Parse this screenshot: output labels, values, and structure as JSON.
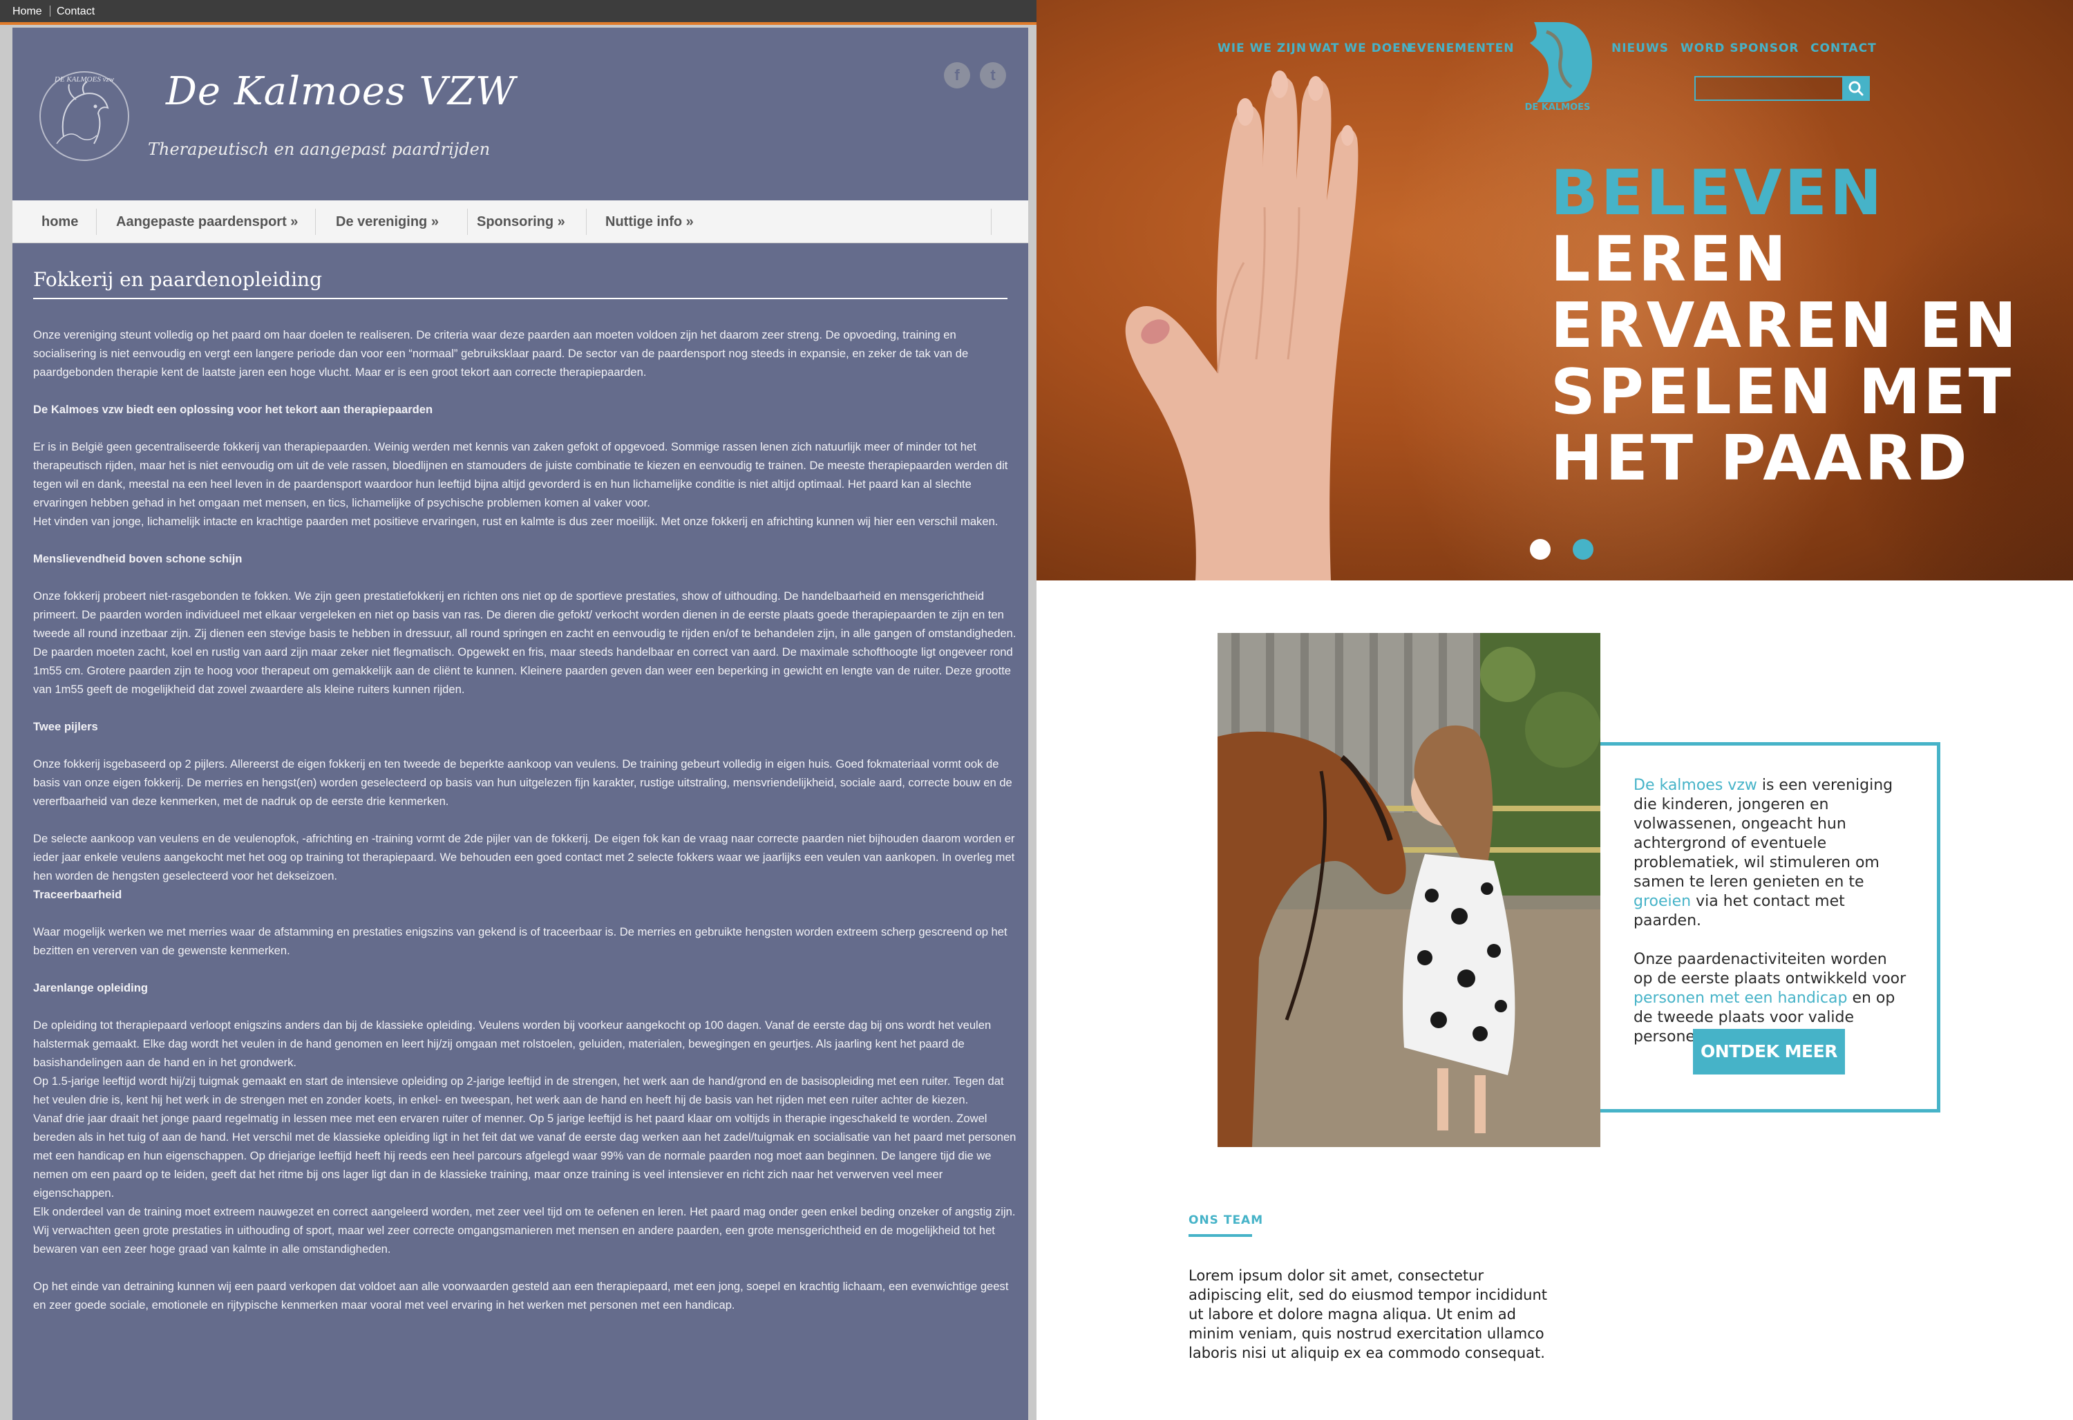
{
  "left": {
    "topbar": {
      "links": [
        "Home",
        "Contact"
      ]
    },
    "header": {
      "title": "De Kalmoes VZW",
      "subtitle": "Therapeutisch en aangepast paardrijden",
      "logo_text": "DE KALMOES vzw",
      "social": {
        "facebook": "f",
        "twitter": "t"
      }
    },
    "nav": [
      "home",
      "Aangepaste paardensport »",
      "De vereniging »",
      "Sponsoring »",
      "Nuttige info »"
    ],
    "article": {
      "title": "Fokkerij en paardenopleiding",
      "paragraphs": [
        "Onze vereniging steunt volledig op het paard om haar doelen te realiseren. De criteria waar deze paarden aan moeten voldoen zijn het daarom zeer streng. De opvoeding, training en socialisering is niet eenvoudig en vergt een langere periode dan voor een “normaal” gebruiksklaar paard. De sector van de paardensport nog steeds in expansie, en zeker de tak van de paardgebonden therapie kent de laatste jaren een hoge vlucht. Maar er is een groot tekort aan correcte therapiepaarden.",
        "De Kalmoes vzw biedt een oplossing voor het tekort aan therapiepaarden",
        "Er is in België geen gecentraliseerde fokkerij van therapiepaarden. Weinig werden met kennis van zaken gefokt of opgevoed. Sommige rassen lenen zich natuurlijk meer of minder tot het therapeutisch rijden, maar het is niet eenvoudig om uit de vele rassen, bloedlijnen en stamouders de juiste combinatie te kiezen en eenvoudig te trainen. De meeste therapiepaarden werden dit tegen wil en dank, meestal na een heel leven in de paardensport waardoor hun leeftijd bijna altijd gevorderd is en hun lichamelijke conditie is niet altijd optimaal. Het paard kan al slechte ervaringen hebben gehad in het omgaan met mensen, en tics, lichamelijke of psychische problemen komen al vaker voor.",
        "Het vinden van jonge, lichamelijk intacte en krachtige paarden met positieve ervaringen, rust en kalmte is dus zeer moeilijk. Met onze fokkerij en africhting kunnen wij hier een verschil maken.",
        "Menslievendheid boven schone schijn",
        "Onze fokkerij probeert niet-rasgebonden te fokken. We zijn geen prestatiefokkerij en richten ons niet op de sportieve prestaties, show of uithouding. De handelbaarheid en mensgerichtheid primeert. De paarden worden individueel met elkaar vergeleken en niet op basis van ras. De dieren die gefokt/ verkocht worden dienen in de eerste plaats goede therapiepaarden te zijn en ten tweede all round inzetbaar zijn. Zij dienen een stevige basis te hebben in dressuur, all round springen en zacht en eenvoudig te rijden en/of te behandelen zijn, in alle gangen of omstandigheden. De paarden moeten zacht, koel en rustig van aard zijn maar zeker niet flegmatisch. Opgewekt en fris, maar steeds handelbaar en correct van aard. De maximale schofthoogte ligt ongeveer rond 1m55 cm. Grotere paarden zijn te hoog voor therapeut om gemakkelijk aan de cliënt te kunnen. Kleinere paarden geven dan weer een beperking in gewicht en lengte van de ruiter. Deze grootte van 1m55 geeft de mogelijkheid dat zowel zwaardere als kleine ruiters kunnen rijden.",
        "Twee pijlers",
        "Onze fokkerij isgebaseerd op 2 pijlers. Allereerst de eigen fokkerij en ten tweede de beperkte aankoop van veulens. De training gebeurt volledig in eigen huis. Goed fokmateriaal vormt ook de basis van onze eigen fokkerij. De merries en hengst(en) worden geselecteerd op basis van hun uitgelezen fijn karakter, rustige uitstraling, mensvriendelijkheid, sociale aard, correcte bouw en de vererfbaarheid van deze kenmerken, met de nadruk op de eerste drie kenmerken.",
        "De selecte aankoop van veulens en de veulenopfok, -africhting en -training vormt de 2de pijler van de fokkerij. De eigen fok kan de vraag naar correcte paarden niet bijhouden daarom worden er ieder jaar enkele veulens aangekocht met het oog op training tot therapiepaard. We behouden een goed contact met 2 selecte fokkers waar we jaarlijks een veulen van aankopen. In overleg met hen worden de hengsten geselecteerd voor het dekseizoen.",
        "Traceerbaarheid",
        "Waar mogelijk werken we met merries waar de afstamming en prestaties enigszins van gekend is of traceerbaar is. De merries en gebruikte hengsten worden extreem scherp gescreend op het bezitten en vererven van de gewenste kenmerken.",
        "Jarenlange opleiding",
        "De opleiding tot therapiepaard verloopt enigszins anders dan bij de klassieke opleiding. Veulens worden bij voorkeur aangekocht op 100 dagen. Vanaf de eerste dag bij ons wordt het veulen halstermak gemaakt. Elke dag wordt het veulen in de hand genomen en leert hij/zij omgaan met rolstoelen, geluiden, materialen, bewegingen en geurtjes. Als jaarling kent het paard de basishandelingen aan de hand en in het grondwerk.",
        "Op 1.5-jarige leeftijd wordt hij/zij tuigmak gemaakt en start de intensieve opleiding op 2-jarige leeftijd in de strengen, het werk aan de hand/grond en de basisopleiding met een ruiter. Tegen dat het veulen drie is, kent hij het werk in de strengen met en zonder koets, in enkel- en tweespan, het werk aan de hand en heeft hij de basis van het rijden met een ruiter achter de kiezen.",
        "Vanaf drie jaar draait het jonge paard regelmatig in lessen mee met een ervaren ruiter of menner. Op 5 jarige leeftijd is het paard klaar om voltijds in therapie ingeschakeld te worden. Zowel bereden als in het tuig of aan de hand. Het verschil met de klassieke opleiding ligt in het feit dat we vanaf de eerste dag werken aan het zadel/tuigmak en socialisatie van het paard met personen met een handicap en hun eigenschappen. Op driejarige leeftijd heeft hij reeds een heel parcours afgelegd waar 99% van de normale paarden nog moet aan beginnen. De langere tijd die we nemen om een paard op te leiden, geeft dat het ritme bij ons lager ligt dan in de klassieke training, maar onze training is veel intensiever en richt zich naar het verwerven veel meer eigenschappen.",
        "Elk onderdeel van de training moet extreem nauwgezet en correct aangeleerd worden, met zeer veel tijd om te oefenen en leren. Het paard mag onder geen enkel beding onzeker of angstig zijn. Wij verwachten geen grote prestaties in uithouding of sport, maar wel zeer correcte omgangsmanieren met mensen en andere paarden, een grote mensgerichtheid en de mogelijkheid tot het bewaren van een zeer hoge graad van kalmte in alle omstandigheden.",
        "Op het einde van detraining kunnen wij een paard verkopen dat voldoet aan alle voorwaarden gesteld aan een therapiepaard, met een jong, soepel en krachtig lichaam, een evenwichtige geest en zeer goede sociale, emotionele en rijtypische kenmerken maar vooral met veel ervaring in het werken met personen met een handicap."
      ]
    }
  },
  "right": {
    "nav_left": [
      "WIE WE ZIJN",
      "WAT WE DOEN",
      "EVENEMENTEN"
    ],
    "nav_right": [
      "NIEUWS",
      "WORD SPONSOR",
      "CONTACT"
    ],
    "brand": "DE KALMOES",
    "search_placeholder": "",
    "headline": [
      "BELEVEN",
      "LEREN",
      "ERVAREN EN",
      "SPELEN MET",
      "HET PAARD"
    ],
    "slider_dots": 2,
    "intro": {
      "p1_accent1": "De kalmoes vzw",
      "p1_text1": " is een vereniging die kinderen, jongeren en volwassenen, ongeacht hun achtergrond of eventuele problematiek, wil stimuleren om samen te leren genieten en te ",
      "p1_accent2": "groeien",
      "p1_text2": " via het contact met paarden.",
      "p2_text1": "Onze paardenactiviteiten worden op de eerste plaats ontwikkeld voor ",
      "p2_accent": "personen met een handicap",
      "p2_text2": " en op de tweede plaats voor valide personen.",
      "button": "ONTDEK MEER"
    },
    "team": {
      "label": "ONS TEAM",
      "text": "Lorem ipsum dolor sit amet, consectetur adipiscing elit, sed do eiusmod tempor incididunt ut labore et dolore magna aliqua. Ut enim ad minim veniam, quis nostrud exercitation ullamco laboris nisi ut aliquip ex ea commodo consequat."
    },
    "colors": {
      "accent": "#46b3c8",
      "old_bg": "#656c8c",
      "topbar_accent": "#e07b2b"
    }
  }
}
